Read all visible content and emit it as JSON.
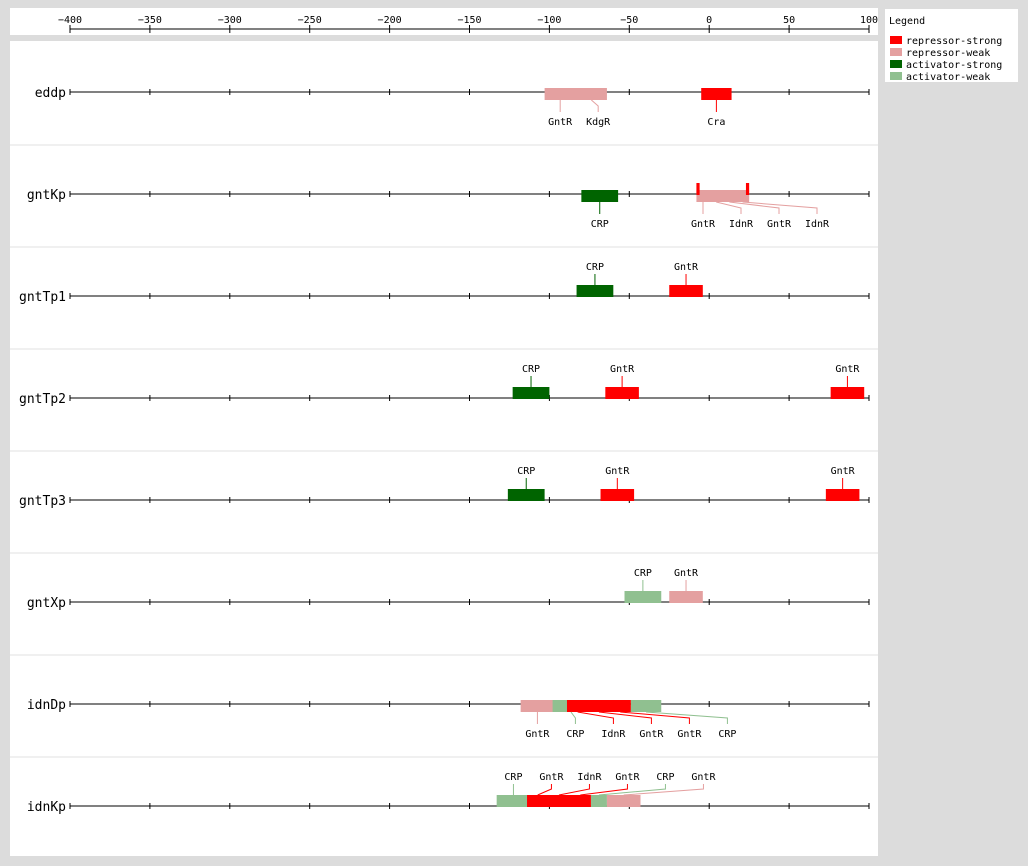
{
  "axis": {
    "ticks": [
      -400,
      -350,
      -300,
      -250,
      -200,
      -150,
      -100,
      -50,
      0,
      50,
      100
    ],
    "range": [
      -400,
      100
    ]
  },
  "legend": {
    "title": "Legend",
    "items": [
      {
        "label": "repressor-strong",
        "color": "#ff0000"
      },
      {
        "label": "repressor-weak",
        "color": "#e4a0a0"
      },
      {
        "label": "activator-strong",
        "color": "#006400"
      },
      {
        "label": "activator-weak",
        "color": "#90c090"
      }
    ]
  },
  "promoters": [
    {
      "name": "eddp",
      "sites": [
        {
          "type": "repressor-weak",
          "start": -103,
          "end": -64,
          "labels_below": [
            "GntR",
            "KdgR"
          ]
        },
        {
          "type": "repressor-strong",
          "start": -5,
          "end": 14,
          "labels_below": [
            "Cra"
          ]
        }
      ]
    },
    {
      "name": "gntKp",
      "sites": [
        {
          "type": "activator-strong",
          "start": -80,
          "end": -57,
          "labels_below": [
            "CRP"
          ]
        },
        {
          "type": "repressor-weak",
          "start": -8,
          "end": 25,
          "labels_below": [
            "GntR",
            "IdnR",
            "GntR",
            "IdnR"
          ]
        },
        {
          "type": "repressor-strong",
          "start": -8,
          "end": -6
        },
        {
          "type": "repressor-strong",
          "start": 23,
          "end": 25
        }
      ]
    },
    {
      "name": "gntTp1",
      "sites": [
        {
          "type": "activator-strong",
          "start": -83,
          "end": -60,
          "labels_above": [
            "CRP"
          ]
        },
        {
          "type": "repressor-strong",
          "start": -25,
          "end": -4,
          "labels_above": [
            "GntR"
          ]
        }
      ]
    },
    {
      "name": "gntTp2",
      "sites": [
        {
          "type": "activator-strong",
          "start": -123,
          "end": -100,
          "labels_above": [
            "CRP"
          ]
        },
        {
          "type": "repressor-strong",
          "start": -65,
          "end": -44,
          "labels_above": [
            "GntR"
          ]
        },
        {
          "type": "repressor-strong",
          "start": 76,
          "end": 97,
          "labels_above": [
            "GntR"
          ]
        }
      ]
    },
    {
      "name": "gntTp3",
      "sites": [
        {
          "type": "activator-strong",
          "start": -126,
          "end": -103,
          "labels_above": [
            "CRP"
          ]
        },
        {
          "type": "repressor-strong",
          "start": -68,
          "end": -47,
          "labels_above": [
            "GntR"
          ]
        },
        {
          "type": "repressor-strong",
          "start": 73,
          "end": 94,
          "labels_above": [
            "GntR"
          ]
        }
      ]
    },
    {
      "name": "gntXp",
      "sites": [
        {
          "type": "activator-weak",
          "start": -53,
          "end": -30,
          "labels_above": [
            "CRP"
          ]
        },
        {
          "type": "repressor-weak",
          "start": -25,
          "end": -4,
          "labels_above": [
            "GntR"
          ]
        }
      ]
    },
    {
      "name": "idnDp",
      "sites": [
        {
          "type": "repressor-weak",
          "start": -118,
          "end": -97,
          "labels_below": [
            "GntR"
          ]
        },
        {
          "type": "activator-weak",
          "start": -98,
          "end": -75,
          "labels_below": [
            "CRP"
          ]
        },
        {
          "type": "repressor-strong",
          "start": -89,
          "end": -49,
          "labels_below": [
            "IdnR",
            "GntR",
            "GntR"
          ]
        },
        {
          "type": "activator-weak",
          "start": -49,
          "end": -30,
          "labels_below": [
            "CRP"
          ]
        }
      ]
    },
    {
      "name": "idnKp",
      "sites": [
        {
          "type": "activator-weak",
          "start": -133,
          "end": -112,
          "labels_above": [
            "CRP"
          ]
        },
        {
          "type": "repressor-strong",
          "start": -114,
          "end": -74,
          "labels_above": [
            "GntR",
            "IdnR",
            "GntR"
          ]
        },
        {
          "type": "activator-weak",
          "start": -74,
          "end": -64,
          "labels_above": [
            "CRP"
          ]
        },
        {
          "type": "repressor-weak",
          "start": -64,
          "end": -43,
          "labels_above": [
            "GntR"
          ]
        }
      ]
    }
  ]
}
